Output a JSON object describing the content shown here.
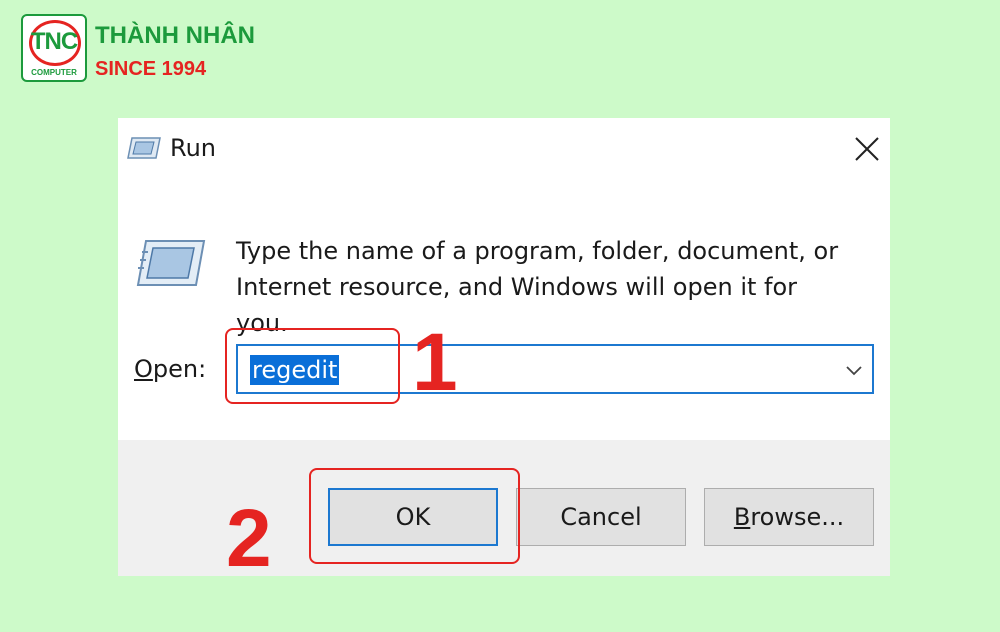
{
  "brand": {
    "badge_text": "TNC",
    "badge_subtext": "COMPUTER",
    "name": "THÀNH NHÂN",
    "since": "SINCE 1994",
    "colors": {
      "green": "#1c9a3c",
      "red": "#e52421"
    }
  },
  "dialog": {
    "title": "Run",
    "message_line1": "Type the name of a program, folder, document, or",
    "message_line2": "Internet resource, and Windows will open it for you.",
    "open_label_mnemonic": "O",
    "open_label_rest": "pen:",
    "open_value": "regedit",
    "buttons": {
      "ok": "OK",
      "cancel": "Cancel",
      "browse_mnemonic": "B",
      "browse_rest": "rowse..."
    },
    "icons": {
      "title": "run-app-icon",
      "main": "run-app-icon",
      "close": "close-icon",
      "dropdown": "chevron-down-icon"
    }
  },
  "annotations": {
    "step1": "1",
    "step2": "2",
    "color": "#e52421"
  }
}
